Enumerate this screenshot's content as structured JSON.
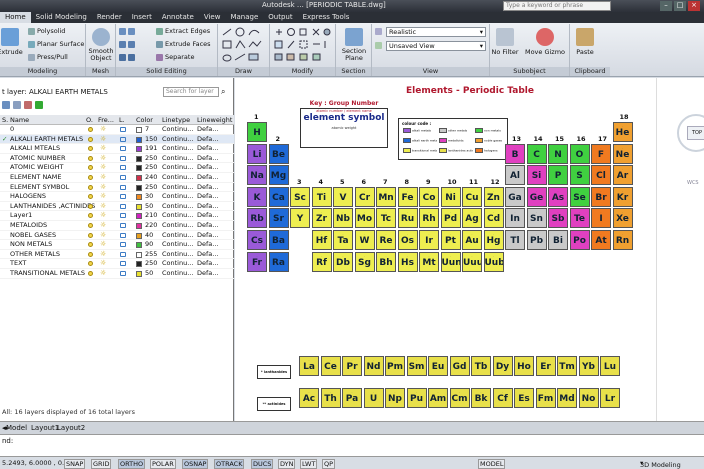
{
  "titlebar": {
    "title": "Autodesk … [PERIODIC TABLE.dwg]",
    "search_placeholder": "Type a keyword or phrase"
  },
  "menu": [
    "Home",
    "Solid Modeling",
    "Render",
    "Insert",
    "Annotate",
    "View",
    "Manage",
    "Output",
    "Express Tools"
  ],
  "ribbon": {
    "modeling": {
      "extrude": "Extrude",
      "polysolid": "Polysolid",
      "planar_surface": "Planar Surface",
      "press_pull": "Press/Pull",
      "label": "Modeling"
    },
    "mesh": {
      "smooth": "Smooth Object",
      "label": "Mesh"
    },
    "solid_editing": {
      "extract": "Extract Edges",
      "extrude_faces": "Extrude Faces",
      "separate": "Separate",
      "label": "Solid Editing"
    },
    "draw": {
      "label": "Draw"
    },
    "modify": {
      "label": "Modify"
    },
    "section": {
      "plane": "Section Plane",
      "label": "Section"
    },
    "view": {
      "visual_style": "Realistic",
      "saved_view": "Unsaved View",
      "label": "View"
    },
    "subobject": {
      "no_filter": "No Filter",
      "move_gizmo": "Move Gizmo",
      "label": "Subobject"
    },
    "clipboard": {
      "paste": "Paste",
      "label": "Clipboard"
    }
  },
  "layers": {
    "current": "t layer: ALKALI EARTH METALS",
    "search_placeholder": "Search for layer",
    "columns": {
      "name": "Name",
      "on": "O.",
      "freeze": "Fre...",
      "lock": "L.",
      "color": "Color",
      "linetype": "Linetype",
      "lineweight": "Lineweight"
    },
    "rows": [
      {
        "name": "0",
        "color_num": "7",
        "swatch": "#ffffff",
        "lt": "Continu...",
        "lw": "Defa..."
      },
      {
        "name": "ALKALI EARTH METALS",
        "color_num": "150",
        "swatch": "#1f5fd0",
        "lt": "Continu...",
        "lw": "Defa..."
      },
      {
        "name": "ALKALI MTEALS",
        "color_num": "191",
        "swatch": "#9a3ad0",
        "lt": "Continu...",
        "lw": "Defa..."
      },
      {
        "name": "ATOMIC NUMBER",
        "color_num": "250",
        "swatch": "#222222",
        "lt": "Continu...",
        "lw": "Defa..."
      },
      {
        "name": "ATOMIC WEIGHT",
        "color_num": "250",
        "swatch": "#222222",
        "lt": "Continu...",
        "lw": "Defa..."
      },
      {
        "name": "ELEMENT NAME",
        "color_num": "240",
        "swatch": "#d0304a",
        "lt": "Continu...",
        "lw": "Defa..."
      },
      {
        "name": "ELEMENT SYMBOL",
        "color_num": "250",
        "swatch": "#222222",
        "lt": "Continu...",
        "lw": "Defa..."
      },
      {
        "name": "HALOGENS",
        "color_num": "30",
        "swatch": "#f08a20",
        "lt": "Continu...",
        "lw": "Defa..."
      },
      {
        "name": "LANTHANIDES ,ACTINIDES",
        "color_num": "50",
        "swatch": "#e8e030",
        "lt": "Continu...",
        "lw": "Defa..."
      },
      {
        "name": "Layer1",
        "color_num": "210",
        "swatch": "#d020c0",
        "lt": "Continu...",
        "lw": "Defa..."
      },
      {
        "name": "METALOIDS",
        "color_num": "220",
        "swatch": "#e030a0",
        "lt": "Continu...",
        "lw": "Defa..."
      },
      {
        "name": "NOBEL GASES",
        "color_num": "40",
        "swatch": "#e8a020",
        "lt": "Continu...",
        "lw": "Defa..."
      },
      {
        "name": "NON METALS",
        "color_num": "90",
        "swatch": "#40c040",
        "lt": "Continu...",
        "lw": "Defa..."
      },
      {
        "name": "OTHER METALS",
        "color_num": "255",
        "swatch": "#ffffff",
        "lt": "Continu...",
        "lw": "Defa..."
      },
      {
        "name": "TEXT",
        "color_num": "250",
        "swatch": "#222222",
        "lt": "Continu...",
        "lw": "Defa..."
      },
      {
        "name": "TRANSITIONAL METALS",
        "color_num": "50",
        "swatch": "#e8e030",
        "lt": "Continu...",
        "lw": "Defa..."
      }
    ],
    "footer": "All: 16 layers displayed of 16 total layers"
  },
  "drawing": {
    "title": "Elements - Periodic Table",
    "key_title": "Key : Group Number",
    "key_small": "atomic number / element name",
    "key_symbol": "element symbol",
    "key_weight": "atomic weight",
    "legend_title": "colour code :",
    "legend": [
      {
        "label": "alkali metals",
        "color": "#9a5ad8"
      },
      {
        "label": "other metals",
        "color": "#c9c9c9"
      },
      {
        "label": "non metals",
        "color": "#40d040"
      },
      {
        "label": "alkali earth metals",
        "color": "#1f6ad8"
      },
      {
        "label": "metalloids",
        "color": "#e040c0"
      },
      {
        "label": "noble gases",
        "color": "#f0a030"
      },
      {
        "label": "transitional metals",
        "color": "#eeee50"
      },
      {
        "label": "lanthanides actinides",
        "color": "#e8e04a"
      },
      {
        "label": "halogens",
        "color": "#f07a20"
      }
    ],
    "lanthanides_label": "* lanthanides",
    "actinides_label": "** actinides",
    "group_numbers": [
      "1",
      "2",
      "3",
      "4",
      "5",
      "6",
      "7",
      "8",
      "9",
      "10",
      "11",
      "12",
      "13",
      "14",
      "15",
      "16",
      "17",
      "18"
    ],
    "colors": {
      "alkali": "#9a5ad8",
      "alkaline": "#1f6ad8",
      "transition": "#eeee50",
      "other": "#c9c9c9",
      "nonmetal": "#40d040",
      "halogen": "#f07a20",
      "noble": "#f0a030",
      "metalloid": "#e040c0",
      "lanth": "#e8e04a"
    },
    "elements": [
      {
        "s": "H",
        "g": 1,
        "p": 1,
        "t": "nonmetal"
      },
      {
        "s": "He",
        "g": 18,
        "p": 1,
        "t": "noble"
      },
      {
        "s": "Li",
        "g": 1,
        "p": 2,
        "t": "alkali"
      },
      {
        "s": "Be",
        "g": 2,
        "p": 2,
        "t": "alkaline"
      },
      {
        "s": "B",
        "g": 13,
        "p": 2,
        "t": "metalloid"
      },
      {
        "s": "C",
        "g": 14,
        "p": 2,
        "t": "nonmetal"
      },
      {
        "s": "N",
        "g": 15,
        "p": 2,
        "t": "nonmetal"
      },
      {
        "s": "O",
        "g": 16,
        "p": 2,
        "t": "nonmetal"
      },
      {
        "s": "F",
        "g": 17,
        "p": 2,
        "t": "halogen"
      },
      {
        "s": "Ne",
        "g": 18,
        "p": 2,
        "t": "noble"
      },
      {
        "s": "Na",
        "g": 1,
        "p": 3,
        "t": "alkali"
      },
      {
        "s": "Mg",
        "g": 2,
        "p": 3,
        "t": "alkaline"
      },
      {
        "s": "Al",
        "g": 13,
        "p": 3,
        "t": "other"
      },
      {
        "s": "Si",
        "g": 14,
        "p": 3,
        "t": "metalloid"
      },
      {
        "s": "P",
        "g": 15,
        "p": 3,
        "t": "nonmetal"
      },
      {
        "s": "S",
        "g": 16,
        "p": 3,
        "t": "nonmetal"
      },
      {
        "s": "Cl",
        "g": 17,
        "p": 3,
        "t": "halogen"
      },
      {
        "s": "Ar",
        "g": 18,
        "p": 3,
        "t": "noble"
      },
      {
        "s": "K",
        "g": 1,
        "p": 4,
        "t": "alkali"
      },
      {
        "s": "Ca",
        "g": 2,
        "p": 4,
        "t": "alkaline"
      },
      {
        "s": "Sc",
        "g": 3,
        "p": 4,
        "t": "transition"
      },
      {
        "s": "Ti",
        "g": 4,
        "p": 4,
        "t": "transition"
      },
      {
        "s": "V",
        "g": 5,
        "p": 4,
        "t": "transition"
      },
      {
        "s": "Cr",
        "g": 6,
        "p": 4,
        "t": "transition"
      },
      {
        "s": "Mn",
        "g": 7,
        "p": 4,
        "t": "transition"
      },
      {
        "s": "Fe",
        "g": 8,
        "p": 4,
        "t": "transition"
      },
      {
        "s": "Co",
        "g": 9,
        "p": 4,
        "t": "transition"
      },
      {
        "s": "Ni",
        "g": 10,
        "p": 4,
        "t": "transition"
      },
      {
        "s": "Cu",
        "g": 11,
        "p": 4,
        "t": "transition"
      },
      {
        "s": "Zn",
        "g": 12,
        "p": 4,
        "t": "transition"
      },
      {
        "s": "Ga",
        "g": 13,
        "p": 4,
        "t": "other"
      },
      {
        "s": "Ge",
        "g": 14,
        "p": 4,
        "t": "metalloid"
      },
      {
        "s": "As",
        "g": 15,
        "p": 4,
        "t": "metalloid"
      },
      {
        "s": "Se",
        "g": 16,
        "p": 4,
        "t": "nonmetal"
      },
      {
        "s": "Br",
        "g": 17,
        "p": 4,
        "t": "halogen"
      },
      {
        "s": "Kr",
        "g": 18,
        "p": 4,
        "t": "noble"
      },
      {
        "s": "Rb",
        "g": 1,
        "p": 5,
        "t": "alkali"
      },
      {
        "s": "Sr",
        "g": 2,
        "p": 5,
        "t": "alkaline"
      },
      {
        "s": "Y",
        "g": 3,
        "p": 5,
        "t": "transition"
      },
      {
        "s": "Zr",
        "g": 4,
        "p": 5,
        "t": "transition"
      },
      {
        "s": "Nb",
        "g": 5,
        "p": 5,
        "t": "transition"
      },
      {
        "s": "Mo",
        "g": 6,
        "p": 5,
        "t": "transition"
      },
      {
        "s": "Tc",
        "g": 7,
        "p": 5,
        "t": "transition"
      },
      {
        "s": "Ru",
        "g": 8,
        "p": 5,
        "t": "transition"
      },
      {
        "s": "Rh",
        "g": 9,
        "p": 5,
        "t": "transition"
      },
      {
        "s": "Pd",
        "g": 10,
        "p": 5,
        "t": "transition"
      },
      {
        "s": "Ag",
        "g": 11,
        "p": 5,
        "t": "transition"
      },
      {
        "s": "Cd",
        "g": 12,
        "p": 5,
        "t": "transition"
      },
      {
        "s": "In",
        "g": 13,
        "p": 5,
        "t": "other"
      },
      {
        "s": "Sn",
        "g": 14,
        "p": 5,
        "t": "other"
      },
      {
        "s": "Sb",
        "g": 15,
        "p": 5,
        "t": "metalloid"
      },
      {
        "s": "Te",
        "g": 16,
        "p": 5,
        "t": "metalloid"
      },
      {
        "s": "I",
        "g": 17,
        "p": 5,
        "t": "halogen"
      },
      {
        "s": "Xe",
        "g": 18,
        "p": 5,
        "t": "noble"
      },
      {
        "s": "Cs",
        "g": 1,
        "p": 6,
        "t": "alkali"
      },
      {
        "s": "Ba",
        "g": 2,
        "p": 6,
        "t": "alkaline"
      },
      {
        "s": "Hf",
        "g": 4,
        "p": 6,
        "t": "transition"
      },
      {
        "s": "Ta",
        "g": 5,
        "p": 6,
        "t": "transition"
      },
      {
        "s": "W",
        "g": 6,
        "p": 6,
        "t": "transition"
      },
      {
        "s": "Re",
        "g": 7,
        "p": 6,
        "t": "transition"
      },
      {
        "s": "Os",
        "g": 8,
        "p": 6,
        "t": "transition"
      },
      {
        "s": "Ir",
        "g": 9,
        "p": 6,
        "t": "transition"
      },
      {
        "s": "Pt",
        "g": 10,
        "p": 6,
        "t": "transition"
      },
      {
        "s": "Au",
        "g": 11,
        "p": 6,
        "t": "transition"
      },
      {
        "s": "Hg",
        "g": 12,
        "p": 6,
        "t": "transition"
      },
      {
        "s": "Tl",
        "g": 13,
        "p": 6,
        "t": "other"
      },
      {
        "s": "Pb",
        "g": 14,
        "p": 6,
        "t": "other"
      },
      {
        "s": "Bi",
        "g": 15,
        "p": 6,
        "t": "other"
      },
      {
        "s": "Po",
        "g": 16,
        "p": 6,
        "t": "metalloid"
      },
      {
        "s": "At",
        "g": 17,
        "p": 6,
        "t": "halogen"
      },
      {
        "s": "Rn",
        "g": 18,
        "p": 6,
        "t": "noble"
      },
      {
        "s": "Fr",
        "g": 1,
        "p": 7,
        "t": "alkali"
      },
      {
        "s": "Ra",
        "g": 2,
        "p": 7,
        "t": "alkaline"
      },
      {
        "s": "Rf",
        "g": 4,
        "p": 7,
        "t": "transition"
      },
      {
        "s": "Db",
        "g": 5,
        "p": 7,
        "t": "transition"
      },
      {
        "s": "Sg",
        "g": 6,
        "p": 7,
        "t": "transition"
      },
      {
        "s": "Bh",
        "g": 7,
        "p": 7,
        "t": "transition"
      },
      {
        "s": "Hs",
        "g": 8,
        "p": 7,
        "t": "transition"
      },
      {
        "s": "Mt",
        "g": 9,
        "p": 7,
        "t": "transition"
      },
      {
        "s": "Uun",
        "g": 10,
        "p": 7,
        "t": "transition"
      },
      {
        "s": "Uuu",
        "g": 11,
        "p": 7,
        "t": "transition"
      },
      {
        "s": "Uub",
        "g": 12,
        "p": 7,
        "t": "transition"
      }
    ],
    "lanthanides": [
      "La",
      "Ce",
      "Pr",
      "Nd",
      "Pm",
      "Sm",
      "Eu",
      "Gd",
      "Tb",
      "Dy",
      "Ho",
      "Er",
      "Tm",
      "Yb",
      "Lu"
    ],
    "actinides": [
      "Ac",
      "Th",
      "Pa",
      "U",
      "Np",
      "Pu",
      "Am",
      "Cm",
      "Bk",
      "Cf",
      "Es",
      "Fm",
      "Md",
      "No",
      "Lr"
    ]
  },
  "viewcube": {
    "top": "TOP",
    "wcs": "WCS"
  },
  "tabs": {
    "model": "Model",
    "layout1": "Layout1",
    "layout2": "Layout2"
  },
  "command": {
    "line": "nd:"
  },
  "status": {
    "coords": "5.2493, 6.0000 , 0.0000",
    "toggles": [
      {
        "label": "SNAP",
        "on": false
      },
      {
        "label": "GRID",
        "on": false
      },
      {
        "label": "ORTHO",
        "on": true
      },
      {
        "label": "POLAR",
        "on": false
      },
      {
        "label": "OSNAP",
        "on": true
      },
      {
        "label": "OTRACK",
        "on": true
      },
      {
        "label": "DUCS",
        "on": true
      },
      {
        "label": "DYN",
        "on": false
      },
      {
        "label": "LWT",
        "on": false
      },
      {
        "label": "QP",
        "on": false
      }
    ],
    "model": "MODEL",
    "workspace": "3D Modeling"
  }
}
